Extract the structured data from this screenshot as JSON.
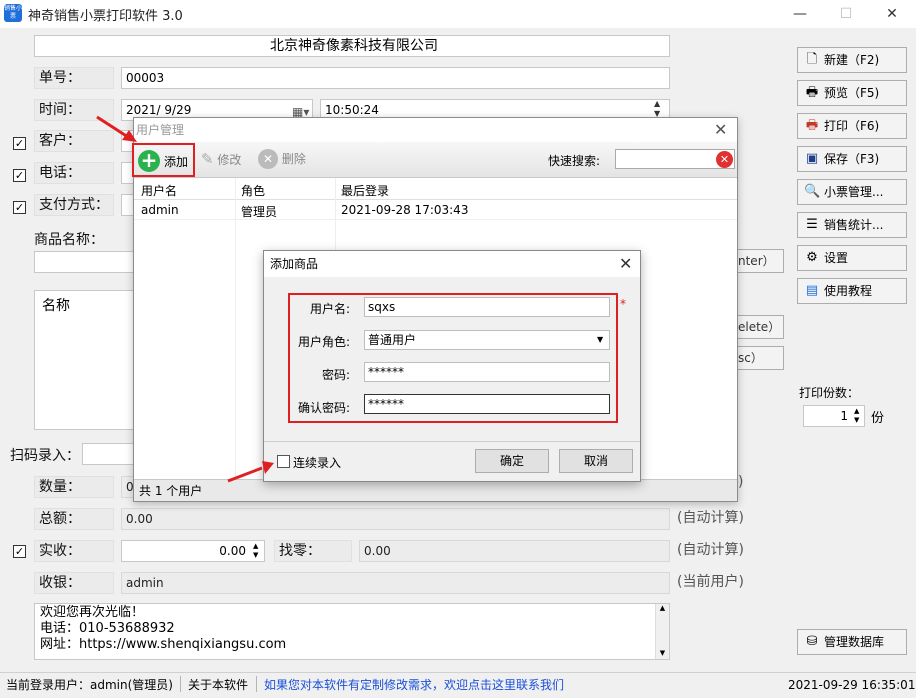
{
  "window": {
    "title": "神奇销售小票打印软件 3.0",
    "icon_text": "销售小票",
    "min": "—",
    "max": "☐",
    "close": "✕"
  },
  "form": {
    "company": "北京神奇像素科技有限公司",
    "order_no_label": "单号：",
    "order_no": "00003",
    "time_label": "时间：",
    "date": "2021/  9/29",
    "time": "10:50:24",
    "customer_label": "客户：",
    "phone_label": "电话：",
    "payment_label": "支付方式：",
    "product_label": "商品名称：",
    "name_col": "名称",
    "scan_label": "扫码录入：",
    "qty_label": "数量：",
    "qty_value": "0",
    "total_label": "总额：",
    "total_value": "0.00",
    "paid_label": "实收：",
    "paid_value": "0.00",
    "change_label": "找零：",
    "change_value": "0.00",
    "cashier_label": "收银：",
    "cashier_value": "admin",
    "auto_calc_1": "(自动计算)",
    "auto_calc_2": "(自动计算)",
    "current_user_hint": "(当前用户)",
    "enter_btn": "nter）",
    "delete_btn": "elete）",
    "esc_btn": "sc）",
    "qty_hint_tail": ")",
    "footer_line1": "欢迎您再次光临！",
    "footer_line2": "电话：010-53688932",
    "footer_line3": "网址：https://www.shenqixiangsu.com"
  },
  "right_buttons": {
    "new": "新建（F2)",
    "preview": "预览（F5)",
    "print": "打印（F6)",
    "save": "保存（F3)",
    "ticket_mgmt": "小票管理...",
    "sales_stats": "销售统计...",
    "settings": "设置",
    "tutorial": "使用教程",
    "print_copies_label": "打印份数：",
    "print_copies": "1",
    "copies_unit": "份",
    "db_mgmt": "管理数据库"
  },
  "statusbar": {
    "current_user": "当前登录用户：admin(管理员)",
    "about": "关于本软件",
    "custom_link": "如果您对本软件有定制修改需求，欢迎点击这里联系我们",
    "datetime": "2021-09-29 16:35:01"
  },
  "user_dialog": {
    "title": "用户管理",
    "add": "添加",
    "edit": "修改",
    "delete": "删除",
    "quick_search": "快速搜索:",
    "columns": [
      "用户名",
      "角色",
      "最后登录"
    ],
    "rows": [
      {
        "username": "admin",
        "role": "管理员",
        "last_login": "2021-09-28 17:03:43"
      }
    ],
    "footer": "共 1 个用户"
  },
  "add_dialog": {
    "title": "添加商品",
    "username_label": "用户名:",
    "username": "sqxs",
    "role_label": "用户角色:",
    "role": "普通用户",
    "password_label": "密码:",
    "password": "******",
    "confirm_label": "确认密码:",
    "confirm": "******",
    "required_mark": "*",
    "continuous": "连续录入",
    "ok": "确定",
    "cancel": "取消"
  },
  "colors": {
    "highlight": "#e02020",
    "link": "#1a4fd8",
    "accent": "#1e6fd9"
  }
}
